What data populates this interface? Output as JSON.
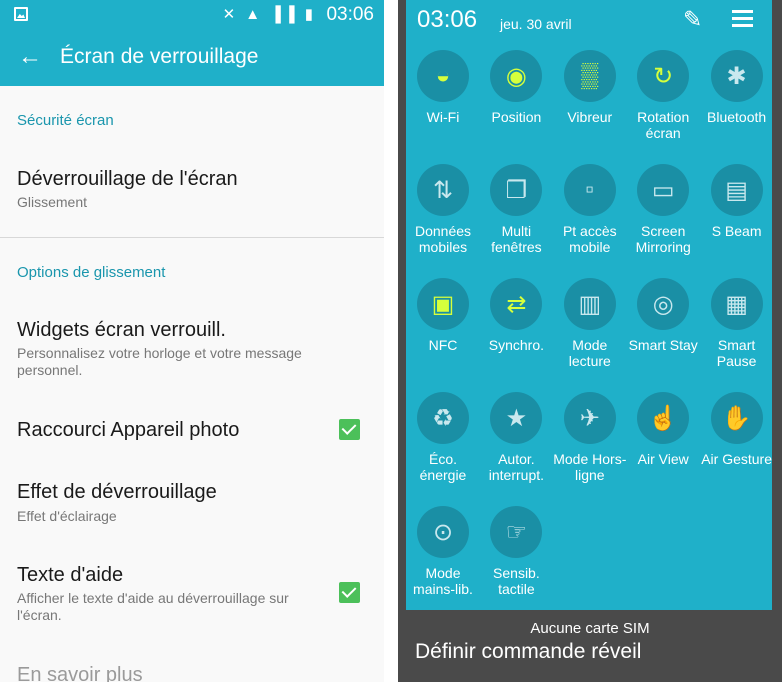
{
  "left": {
    "status_time": "03:06",
    "status_icons": "✕ ▲ ▐▐ ▮",
    "back_glyph": "←",
    "title": "Écran de verrouillage",
    "sections": [
      {
        "label": "Sécurité écran"
      },
      {
        "label": "Options de glissement"
      }
    ],
    "items": [
      {
        "title": "Déverrouillage de l'écran",
        "subtitle": "Glissement"
      },
      {
        "title": "Widgets écran verrouill.",
        "subtitle": "Personnalisez votre horloge et votre message personnel."
      },
      {
        "title": "Raccourci Appareil photo",
        "checked": true
      },
      {
        "title": "Effet de déverrouillage",
        "subtitle": "Effet d'éclairage"
      },
      {
        "title": "Texte d'aide",
        "subtitle": "Afficher le texte d'aide au déverrouillage sur l'écran.",
        "checked": true
      },
      {
        "title": "En savoir plus"
      }
    ]
  },
  "right": {
    "time": "03:06",
    "date": "jeu. 30 avril",
    "edit_glyph": "✎",
    "tiles": [
      {
        "label": "Wi-Fi",
        "icon": "wifi-icon",
        "glyph": "◒",
        "on": true
      },
      {
        "label": "Position",
        "icon": "location-icon",
        "glyph": "◉",
        "on": true
      },
      {
        "label": "Vibreur",
        "icon": "vibrate-icon",
        "glyph": "▒",
        "on": true
      },
      {
        "label": "Rotation écran",
        "icon": "rotation-icon",
        "glyph": "↻",
        "on": true
      },
      {
        "label": "Bluetooth",
        "icon": "bluetooth-icon",
        "glyph": "✱",
        "on": false
      },
      {
        "label": "Données mobiles",
        "icon": "mobile-data-icon",
        "glyph": "⇅",
        "on": false
      },
      {
        "label": "Multi fenêtres",
        "icon": "multi-window-icon",
        "glyph": "❐",
        "on": false
      },
      {
        "label": "Pt accès mobile",
        "icon": "hotspot-icon",
        "glyph": "▫",
        "on": false
      },
      {
        "label": "Screen Mirroring",
        "icon": "screen-mirroring-icon",
        "glyph": "▭",
        "on": false
      },
      {
        "label": "S Beam",
        "icon": "s-beam-icon",
        "glyph": "▤",
        "on": false
      },
      {
        "label": "NFC",
        "icon": "nfc-icon",
        "glyph": "▣",
        "on": true
      },
      {
        "label": "Synchro.",
        "icon": "sync-icon",
        "glyph": "⇄",
        "on": true
      },
      {
        "label": "Mode lecture",
        "icon": "reading-mode-icon",
        "glyph": "▥",
        "on": false
      },
      {
        "label": "Smart Stay",
        "icon": "smart-stay-icon",
        "glyph": "◎",
        "on": false
      },
      {
        "label": "Smart Pause",
        "icon": "smart-pause-icon",
        "glyph": "▦",
        "on": false
      },
      {
        "label": "Éco. énergie",
        "icon": "power-saving-icon",
        "glyph": "♻",
        "on": false
      },
      {
        "label": "Autor. interrupt.",
        "icon": "star-icon",
        "glyph": "★",
        "on": false
      },
      {
        "label": "Mode Hors-ligne",
        "icon": "airplane-icon",
        "glyph": "✈",
        "on": false
      },
      {
        "label": "Air View",
        "icon": "air-view-icon",
        "glyph": "☝",
        "on": false
      },
      {
        "label": "Air Gesture",
        "icon": "air-gesture-icon",
        "glyph": "✋",
        "on": false
      },
      {
        "label": "Mode mains-lib.",
        "icon": "steering-wheel-icon",
        "glyph": "⊙",
        "on": false
      },
      {
        "label": "Sensib. tactile",
        "icon": "touch-sensitivity-icon",
        "glyph": "☞",
        "on": false
      }
    ],
    "sim_text": "Aucune carte SIM",
    "below_text": "Définir commande réveil"
  }
}
